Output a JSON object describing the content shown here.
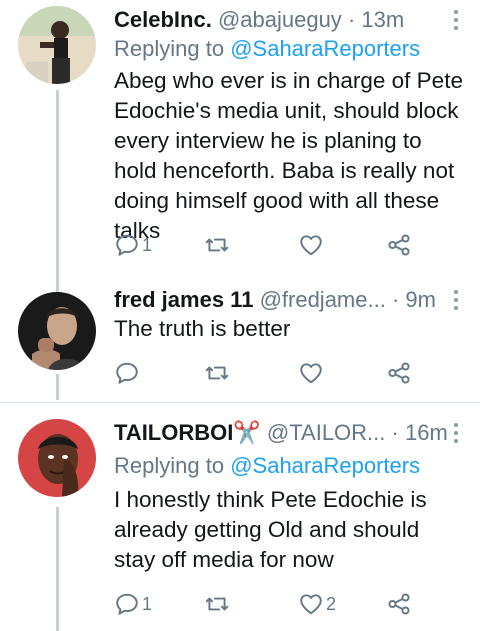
{
  "tweets": [
    {
      "name": "CelebInc.",
      "handle": "@abajueguy",
      "sep": "·",
      "time": "13m",
      "reply_prefix": "Replying to",
      "reply_mention": "@SaharaReporters",
      "text": "Abeg who ever is in charge of Pete Edochie's media unit, should block every interview he is planing to hold henceforth. Baba is really not doing himself good with all these talks",
      "reply_count": "1",
      "retweet_count": "",
      "like_count": ""
    },
    {
      "name": "fred james 11",
      "handle": "@fredjame...",
      "sep": "·",
      "time": "9m",
      "text": "The truth is better",
      "reply_count": "",
      "retweet_count": "",
      "like_count": ""
    },
    {
      "name": "TAILORBOI",
      "name_emoji": "✂️",
      "handle": "@TAILOR...",
      "sep": "·",
      "time": "16m",
      "reply_prefix": "Replying to",
      "reply_mention": "@SaharaReporters",
      "text": "I honestly think Pete Edochie is already getting Old and should stay off media for now",
      "reply_count": "1",
      "retweet_count": "",
      "like_count": "2"
    }
  ],
  "colors": {
    "link": "#1da1f2",
    "secondary_text": "#657786",
    "primary_text": "#14171a",
    "icon": "#657786",
    "thread_line": "#c4cfd6"
  },
  "icons": [
    "reply-icon",
    "retweet-icon",
    "like-icon",
    "share-icon",
    "more-icon"
  ]
}
